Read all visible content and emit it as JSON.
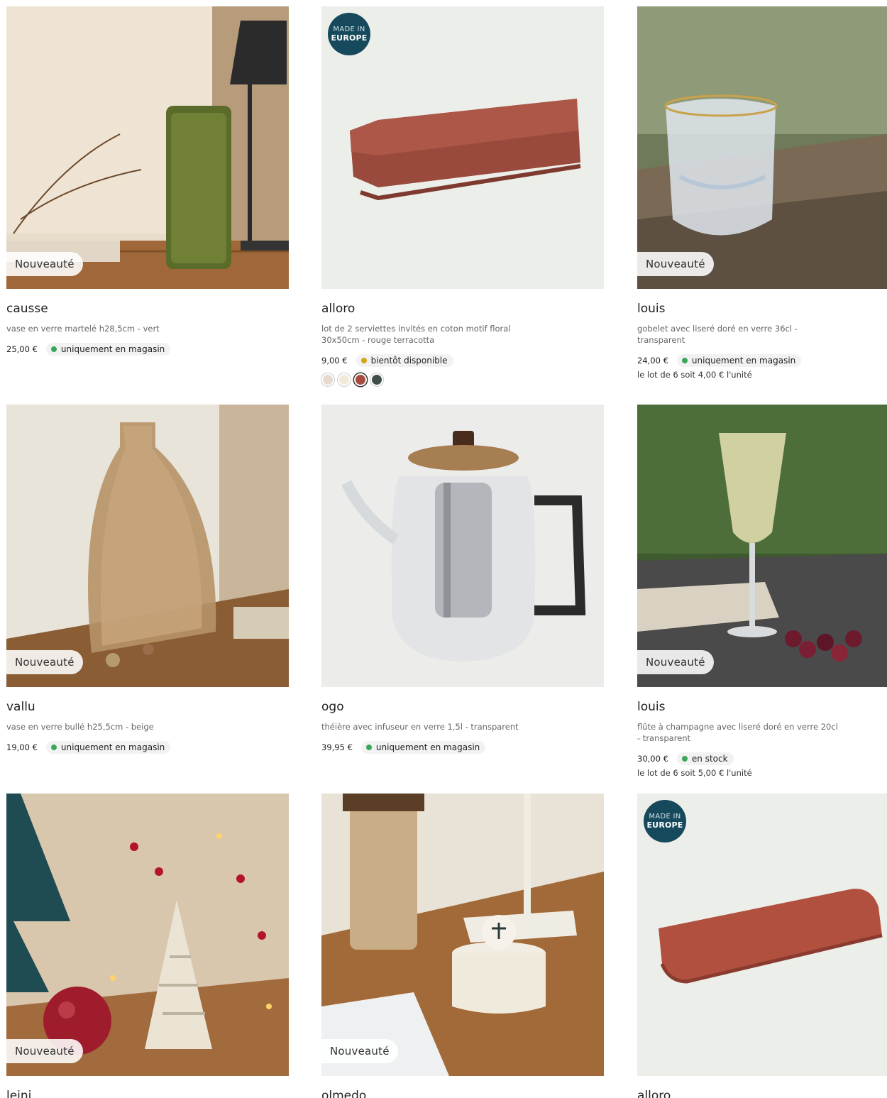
{
  "products": [
    {
      "badge_new": "Nouveauté",
      "name": "causse",
      "description": "vase en verre martelé h28,5cm - vert",
      "price": "25,00 €",
      "availability": "uniquement en magasin",
      "availability_color": "#3aa65a"
    },
    {
      "badge_europe_line1": "MADE IN",
      "badge_europe_line2": "EUROPE",
      "name": "alloro",
      "description": "lot de 2 serviettes invités en coton motif floral 30x50cm - rouge terracotta",
      "price": "9,00 €",
      "availability": "bientôt disponible",
      "availability_color": "#d4a317",
      "swatches": [
        "#e8d8cf",
        "#f3e9d8",
        "#a64b3f",
        "#3f4f48"
      ]
    },
    {
      "badge_new": "Nouveauté",
      "name": "louis",
      "description": "gobelet avec liseré doré en verre 36cl - transparent",
      "price": "24,00 €",
      "availability": "uniquement en magasin",
      "availability_color": "#3aa65a",
      "unit_note": "le lot de 6 soit 4,00 € l'unité"
    },
    {
      "badge_new": "Nouveauté",
      "name": "vallu",
      "description": "vase en verre bullé h25,5cm - beige",
      "price": "19,00 €",
      "availability": "uniquement en magasin",
      "availability_color": "#3aa65a"
    },
    {
      "name": "ogo",
      "description": "théière avec infuseur en verre 1,5l - transparent",
      "price": "39,95 €",
      "availability": "uniquement en magasin",
      "availability_color": "#3aa65a"
    },
    {
      "badge_new": "Nouveauté",
      "name": "louis",
      "description": "flûte à champagne avec liseré doré en verre 20cl - transparent",
      "price": "30,00 €",
      "availability": "en stock",
      "availability_color": "#3aa65a",
      "unit_note": "le lot de 6 soit 5,00 € l'unité"
    },
    {
      "badge_new": "Nouveauté",
      "name": "leini"
    },
    {
      "badge_new": "Nouveauté",
      "name": "olmedo"
    },
    {
      "badge_europe_line1": "MADE IN",
      "badge_europe_line2": "EUROPE",
      "name": "alloro"
    }
  ]
}
